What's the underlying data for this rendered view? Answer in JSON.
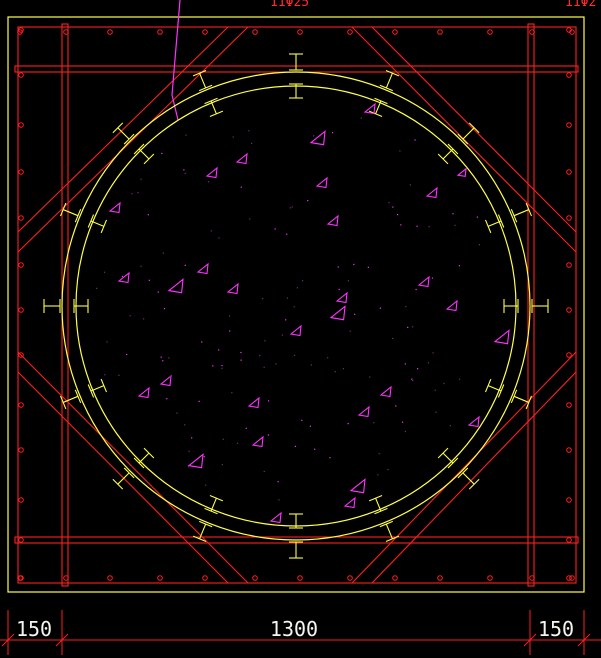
{
  "drawing": {
    "top_label_left": "11Φ25",
    "top_label_right": "11Φ2",
    "dimensions": [
      "150",
      "1300",
      "150"
    ]
  },
  "colors": {
    "background": "#000000",
    "yellow": "#ffff4a",
    "red": "#ff2020",
    "magenta": "#ff33ff",
    "white": "#f5f5f0"
  }
}
